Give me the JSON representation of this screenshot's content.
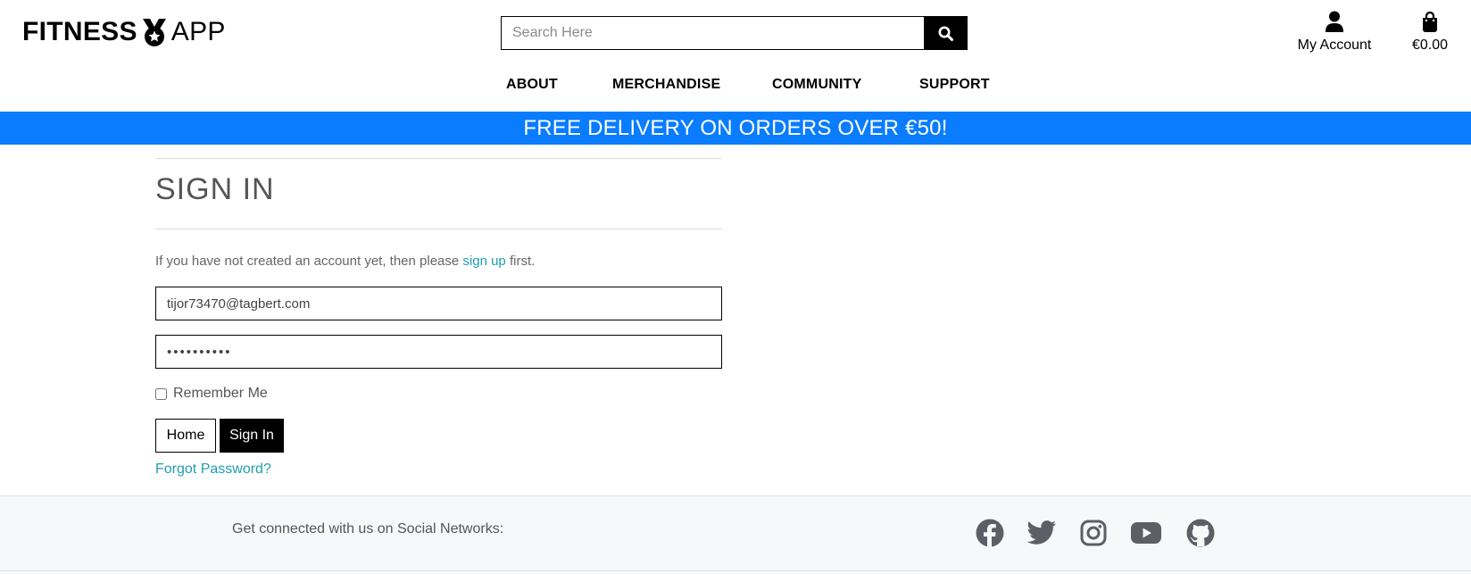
{
  "header": {
    "logo_left": "FITNESS",
    "logo_right": "APP",
    "search_placeholder": "Search Here",
    "account_label": "My Account",
    "cart_total": "€0.00"
  },
  "nav": {
    "items": [
      {
        "label": "ABOUT"
      },
      {
        "label": "MERCHANDISE"
      },
      {
        "label": "COMMUNITY"
      },
      {
        "label": "SUPPORT"
      }
    ]
  },
  "banner": {
    "text": "FREE DELIVERY ON ORDERS OVER €50!"
  },
  "signin": {
    "title": "SIGN IN",
    "intro_before": "If you have not created an account yet, then please ",
    "intro_link": "sign up",
    "intro_after": " first.",
    "email_value": "tijor73470@tagbert.com",
    "password_value": "••••••••••",
    "remember_label": "Remember Me",
    "home_button": "Home",
    "signin_button": "Sign In",
    "forgot_link": "Forgot Password?"
  },
  "footer": {
    "social_text": "Get connected with us on Social Networks:",
    "icons": [
      "facebook-icon",
      "twitter-icon",
      "instagram-icon",
      "youtube-icon",
      "github-icon"
    ],
    "icon_color": "#5c6066"
  },
  "colors": {
    "banner": "#0a7cff",
    "link": "#1f9db1",
    "primary": "#000000"
  }
}
